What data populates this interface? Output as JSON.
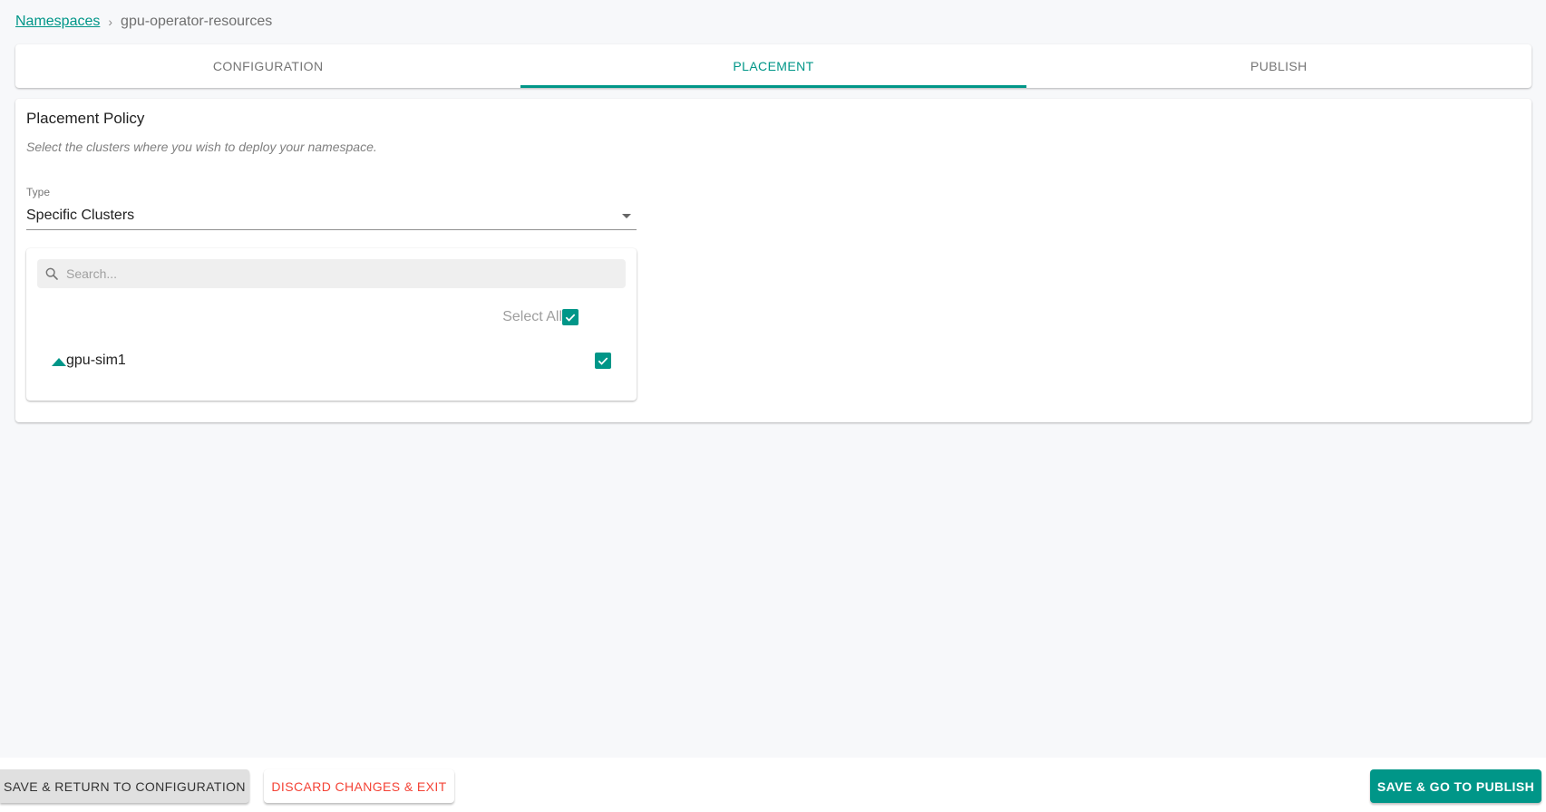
{
  "breadcrumb": {
    "parent": "Namespaces",
    "separator": "›",
    "current": "gpu-operator-resources"
  },
  "tabs": [
    {
      "label": "CONFIGURATION",
      "active": false
    },
    {
      "label": "PLACEMENT",
      "active": true
    },
    {
      "label": "PUBLISH",
      "active": false
    }
  ],
  "placement": {
    "title": "Placement Policy",
    "subtitle": "Select the clusters where you wish to deploy your namespace.",
    "type_label": "Type",
    "type_value": "Specific Clusters",
    "search_placeholder": "Search...",
    "select_all_label": "Select All",
    "select_all_checked": true,
    "clusters": [
      {
        "name": "gpu-sim1",
        "checked": true,
        "icon": "triangle-up-icon"
      }
    ]
  },
  "footer": {
    "return_label": "SAVE & RETURN TO CONFIGURATION",
    "discard_label": "DISCARD CHANGES & EXIT",
    "publish_label": "SAVE & GO TO PUBLISH"
  },
  "colors": {
    "accent": "#009688",
    "danger": "#f44336",
    "background": "#f7f8fa"
  }
}
